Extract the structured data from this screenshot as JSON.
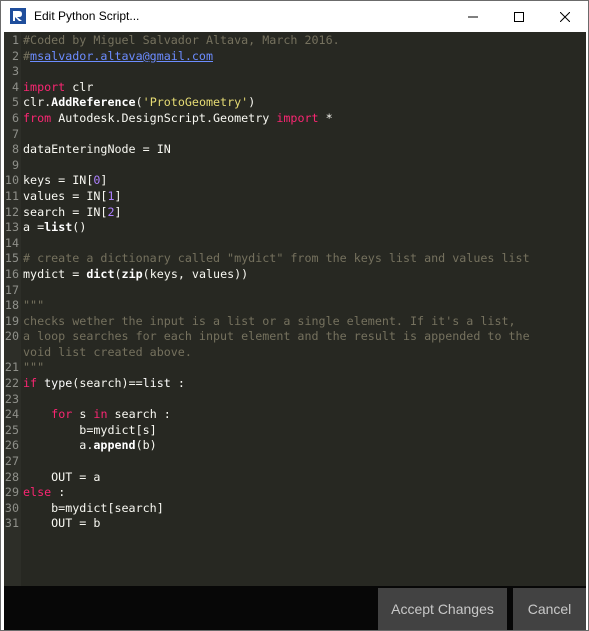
{
  "window": {
    "title": "Edit Python Script..."
  },
  "editor": {
    "lines": [
      {
        "num": "1",
        "tokens": [
          {
            "t": "#Coded by Miguel Salvador Altava, March 2016.",
            "c": "c"
          }
        ]
      },
      {
        "num": "2",
        "tokens": [
          {
            "t": "#",
            "c": "c"
          },
          {
            "t": "msalvador.altava@gmail.com",
            "c": "u"
          }
        ]
      },
      {
        "num": "3",
        "tokens": []
      },
      {
        "num": "4",
        "tokens": [
          {
            "t": "import",
            "c": "k"
          },
          {
            "t": " clr",
            "c": ""
          }
        ]
      },
      {
        "num": "5",
        "tokens": [
          {
            "t": "clr.",
            "c": ""
          },
          {
            "t": "AddReference",
            "c": "f"
          },
          {
            "t": "(",
            "c": ""
          },
          {
            "t": "'ProtoGeometry'",
            "c": "s"
          },
          {
            "t": ")",
            "c": ""
          }
        ]
      },
      {
        "num": "6",
        "tokens": [
          {
            "t": "from",
            "c": "k"
          },
          {
            "t": " Autodesk.DesignScript.Geometry ",
            "c": ""
          },
          {
            "t": "import",
            "c": "k"
          },
          {
            "t": " *",
            "c": ""
          }
        ]
      },
      {
        "num": "7",
        "tokens": []
      },
      {
        "num": "8",
        "tokens": [
          {
            "t": "dataEnteringNode = IN",
            "c": ""
          }
        ]
      },
      {
        "num": "9",
        "tokens": []
      },
      {
        "num": "10",
        "tokens": [
          {
            "t": "keys = IN[",
            "c": ""
          },
          {
            "t": "0",
            "c": "n"
          },
          {
            "t": "]",
            "c": ""
          }
        ]
      },
      {
        "num": "11",
        "tokens": [
          {
            "t": "values = IN[",
            "c": ""
          },
          {
            "t": "1",
            "c": "n"
          },
          {
            "t": "]",
            "c": ""
          }
        ]
      },
      {
        "num": "12",
        "tokens": [
          {
            "t": "search = IN[",
            "c": ""
          },
          {
            "t": "2",
            "c": "n"
          },
          {
            "t": "]",
            "c": ""
          }
        ]
      },
      {
        "num": "13",
        "tokens": [
          {
            "t": "a =",
            "c": ""
          },
          {
            "t": "list",
            "c": "f"
          },
          {
            "t": "()",
            "c": ""
          }
        ]
      },
      {
        "num": "14",
        "tokens": []
      },
      {
        "num": "15",
        "tokens": [
          {
            "t": "# create a dictionary called \"mydict\" from the keys list and values list",
            "c": "c"
          }
        ]
      },
      {
        "num": "16",
        "tokens": [
          {
            "t": "mydict = ",
            "c": ""
          },
          {
            "t": "dict",
            "c": "f"
          },
          {
            "t": "(",
            "c": ""
          },
          {
            "t": "zip",
            "c": "f"
          },
          {
            "t": "(keys, values))",
            "c": ""
          }
        ]
      },
      {
        "num": "17",
        "tokens": []
      },
      {
        "num": "18",
        "tokens": [
          {
            "t": "\"\"\"",
            "c": "c"
          }
        ]
      },
      {
        "num": "19",
        "tokens": [
          {
            "t": "checks wether the input is a list or a single element. If it's a list,",
            "c": "c"
          }
        ]
      },
      {
        "num": "20",
        "tokens": [
          {
            "t": "a loop searches for each input element and the result is appended to the",
            "c": "c"
          }
        ]
      },
      {
        "num": "",
        "tokens": [
          {
            "t": "void list created above.",
            "c": "c"
          }
        ]
      },
      {
        "num": "21",
        "tokens": [
          {
            "t": "\"\"\"",
            "c": "c"
          }
        ]
      },
      {
        "num": "22",
        "tokens": [
          {
            "t": "if",
            "c": "k"
          },
          {
            "t": " ",
            "c": ""
          },
          {
            "t": "type",
            "c": "b"
          },
          {
            "t": "(search)==",
            "c": ""
          },
          {
            "t": "list",
            "c": "b"
          },
          {
            "t": " :",
            "c": ""
          }
        ]
      },
      {
        "num": "23",
        "tokens": []
      },
      {
        "num": "24",
        "tokens": [
          {
            "t": "    ",
            "c": ""
          },
          {
            "t": "for",
            "c": "k"
          },
          {
            "t": " s ",
            "c": ""
          },
          {
            "t": "in",
            "c": "k"
          },
          {
            "t": " search :",
            "c": ""
          }
        ]
      },
      {
        "num": "25",
        "tokens": [
          {
            "t": "        b=mydict[s]",
            "c": ""
          }
        ]
      },
      {
        "num": "26",
        "tokens": [
          {
            "t": "        a.",
            "c": ""
          },
          {
            "t": "append",
            "c": "f"
          },
          {
            "t": "(b)",
            "c": ""
          }
        ]
      },
      {
        "num": "27",
        "tokens": []
      },
      {
        "num": "28",
        "tokens": [
          {
            "t": "    OUT = a",
            "c": ""
          }
        ]
      },
      {
        "num": "29",
        "tokens": [
          {
            "t": "else",
            "c": "k"
          },
          {
            "t": " :",
            "c": ""
          }
        ]
      },
      {
        "num": "30",
        "tokens": [
          {
            "t": "    b=mydict[search]",
            "c": ""
          }
        ]
      },
      {
        "num": "31",
        "tokens": [
          {
            "t": "    OUT = b",
            "c": ""
          }
        ]
      }
    ]
  },
  "footer": {
    "accept_label": "Accept Changes",
    "cancel_label": "Cancel"
  },
  "colors": {
    "editor_bg": "#272822",
    "keyword": "#f92672",
    "string": "#e6db74",
    "number": "#ae81ff",
    "comment": "#75715e",
    "button_bg": "#424242"
  },
  "icons": {
    "app": "revit-dynamo-icon",
    "minimize": "minimize-icon",
    "maximize": "maximize-icon",
    "close": "close-icon"
  }
}
